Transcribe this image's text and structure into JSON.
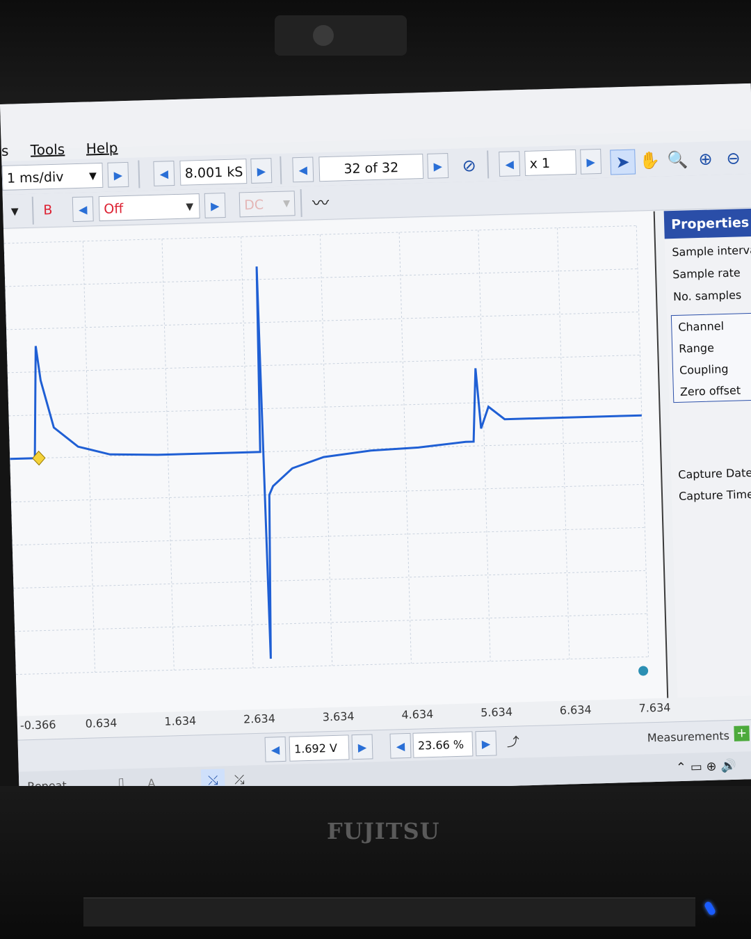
{
  "menu": {
    "partial_left": "s",
    "tools": "Tools",
    "help": "Help"
  },
  "toolbar": {
    "timebase": "1 ms/div",
    "samples": "8.001 kS",
    "buffer": "32 of 32",
    "zoom": "x 1"
  },
  "channel_bar": {
    "channel": "B",
    "mode": "Off",
    "coupling": "DC"
  },
  "properties": {
    "title": "Properties",
    "group1": [
      "Sample interval",
      "Sample rate",
      "No. samples"
    ],
    "group2": [
      "Channel",
      "Range",
      "Coupling",
      "Zero offset"
    ],
    "group3": [
      "Capture Date",
      "Capture Time"
    ]
  },
  "x_ticks": [
    "-0.366",
    "0.634",
    "1.634",
    "2.634",
    "3.634",
    "4.634",
    "5.634",
    "6.634",
    "7.634"
  ],
  "bottom": {
    "threshold": "1.692 V",
    "pretrigger": "23.66 %",
    "measurements": "Measurements"
  },
  "status": {
    "trigger_mode": "Repeat",
    "trigger_channel": "A"
  },
  "brand": "FUJITSU",
  "colors": {
    "trace": "#1f5fd4",
    "panel_header": "#2a4ea8"
  },
  "chart_data": {
    "type": "line",
    "x_unit": "ms",
    "x_ticks": [
      -0.366,
      0.634,
      1.634,
      2.634,
      3.634,
      4.634,
      5.634,
      6.634,
      7.634
    ],
    "xlim": [
      -0.366,
      7.634
    ],
    "grid": true,
    "series": [
      {
        "x": [
          -0.366,
          -0.05,
          0.0,
          0.05,
          0.2,
          0.5,
          0.9,
          1.5,
          2.5,
          2.8,
          2.82,
          2.86,
          2.9,
          2.95,
          3.2,
          3.6,
          4.2,
          4.8,
          5.4,
          5.5,
          5.55,
          5.6,
          5.7,
          5.9,
          6.3,
          7.0,
          7.634
        ],
        "y": [
          0.0,
          0.0,
          1.3,
          0.9,
          0.35,
          0.12,
          0.02,
          0.0,
          0.0,
          0.0,
          2.15,
          -2.4,
          -0.5,
          -0.4,
          -0.2,
          -0.08,
          -0.02,
          0.0,
          0.05,
          0.05,
          0.9,
          0.2,
          0.45,
          0.3,
          0.3,
          0.3,
          0.3
        ]
      }
    ]
  }
}
